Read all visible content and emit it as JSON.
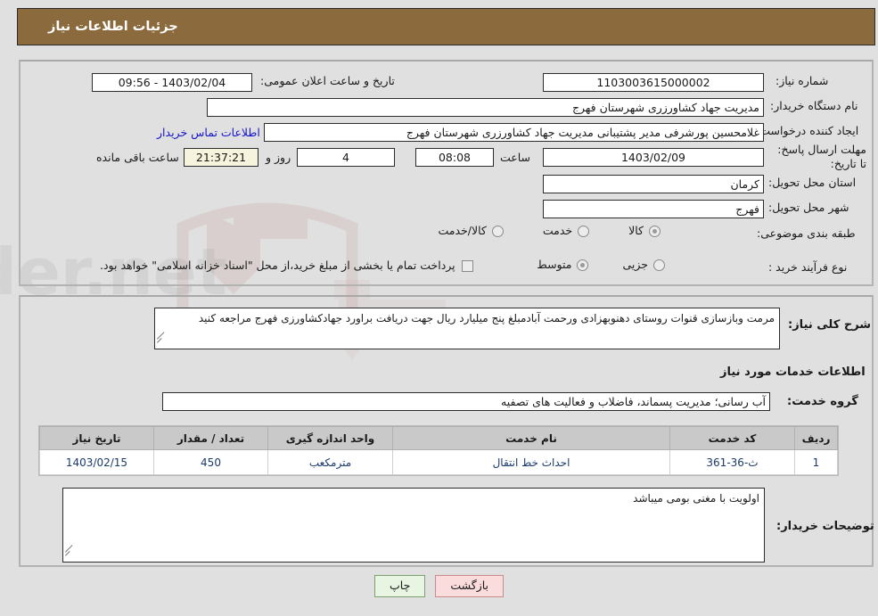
{
  "header": {
    "title": "جزئیات اطلاعات نیاز",
    "bar_color": "#8b6b3d"
  },
  "fields": {
    "need_number_label": "شماره نیاز:",
    "need_number_value": "1103003615000002",
    "announce_label": "تاریخ و ساعت اعلان عمومی:",
    "announce_value": "1403/02/04 - 09:56",
    "buyer_org_label": "نام دستگاه خریدار:",
    "buyer_org_value": "مدیریت جهاد کشاورزری شهرستان فهرج",
    "creator_label": "ایجاد کننده درخواست:",
    "creator_value": "غلامحسین پورشرفی مدیر پشتیبانی مدیریت جهاد کشاورزری شهرستان فهرج",
    "contact_link": "اطلاعات تماس خریدار",
    "deadline_label": "مهلت ارسال پاسخ: تا تاریخ:",
    "deadline_date": "1403/02/09",
    "deadline_hour_label": "ساعت",
    "deadline_hour": "08:08",
    "remaining_days": "4",
    "remaining_days_label": "روز و",
    "remaining_time": "21:37:21",
    "remaining_suffix": "ساعت باقی مانده",
    "province_label": "استان محل تحویل:",
    "province_value": "کرمان",
    "city_label": "شهر محل تحویل:",
    "city_value": "فهرج"
  },
  "classification": {
    "label": "طبقه بندی موضوعی:",
    "options": [
      {
        "text": "کالا",
        "selected": true
      },
      {
        "text": "خدمت",
        "selected": false
      },
      {
        "text": "کالا/خدمت",
        "selected": false
      }
    ]
  },
  "process": {
    "label": "نوع فرآیند خرید :",
    "options": [
      {
        "text": "جزیی",
        "selected": false
      },
      {
        "text": "متوسط",
        "selected": true
      }
    ],
    "checkbox_label": "پرداخت تمام یا بخشی از مبلغ خرید،از محل \"اسناد خزانه اسلامی\" خواهد بود.",
    "checkbox_checked": false
  },
  "description": {
    "label": "شرح کلی نیاز:",
    "value": "مرمت وبازسازی قنوات روستای دهنوبهزادی ورحمت آبادمبلغ پنج میلیارد ریال جهت دریافت براورد جهادکشاورزی فهرج مراجعه کنید"
  },
  "services_section": {
    "heading": "اطلاعات خدمات مورد نیاز",
    "group_label": "گروه خدمت:",
    "group_value": "آب رسانی؛ مدیریت پسماند، فاضلاب و فعالیت های تصفیه"
  },
  "table": {
    "columns": [
      "ردیف",
      "کد خدمت",
      "نام خدمت",
      "واحد اندازه گیری",
      "تعداد / مقدار",
      "تاریخ نیاز"
    ],
    "rows": [
      [
        "1",
        "ث-36-361",
        "احداث خط انتقال",
        "مترمکعب",
        "450",
        "1403/02/15"
      ]
    ]
  },
  "buyer_notes": {
    "label": "توضیحات خریدار:",
    "value": "اولویت با مغنی بومی میباشد"
  },
  "buttons": {
    "print": "چاپ",
    "back": "بازگشت"
  },
  "watermark": {
    "text": "AriaTender.net"
  }
}
